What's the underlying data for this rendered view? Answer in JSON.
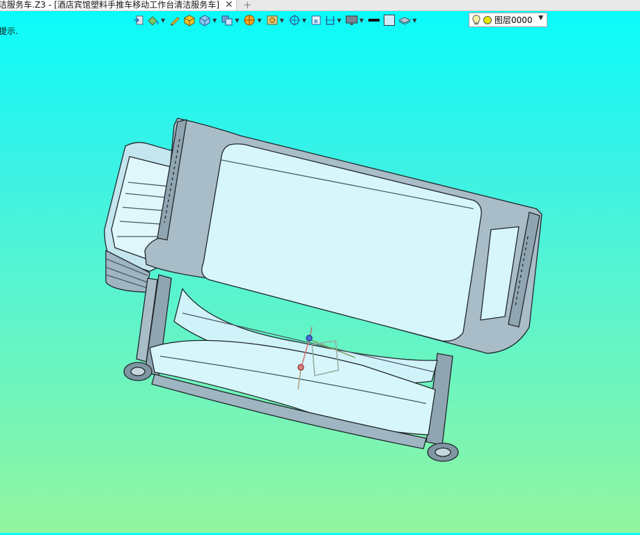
{
  "tab": {
    "title": "洁服务车.Z3 - [酒店宾馆塑料手推车移动工作台清洁服务车]",
    "close_symbol": "✕",
    "new_tab_symbol": "+"
  },
  "toolbar": {
    "icons": [
      "exit-icon",
      "paint-bucket-icon",
      "pencil-icon",
      "solid-box-icon",
      "view-cube-icon",
      "display-mode-icon",
      "render-sphere-icon",
      "image-icon",
      "orbit-icon",
      "fit-view-icon",
      "section-icon",
      "monitor-icon",
      "line-color-swatch",
      "fill-color-swatch",
      "layer-stack-icon"
    ]
  },
  "layer": {
    "label": "图层0000",
    "colors": {
      "bulb": "#f5f1a0",
      "dot": "#e6e600"
    }
  },
  "prompt": {
    "text": "提示."
  },
  "colors": {
    "bg_top": "#06fcfc",
    "bg_bottom": "#92f59e",
    "model_fill": "#d6f6fb",
    "model_edge": "#20262b",
    "frame_gray": "#8fa6b2"
  }
}
